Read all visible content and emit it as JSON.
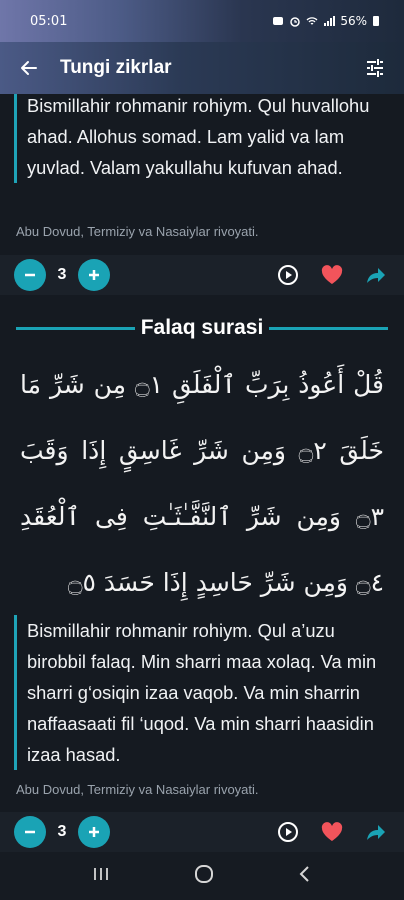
{
  "status": {
    "time": "05:01",
    "battery": "56%"
  },
  "app_bar": {
    "title": "Tungi zikrlar",
    "back_icon": "arrow-left-icon",
    "settings_icon": "tune-icon"
  },
  "ikhlas": {
    "translit": "Bismillahir rohmanir rohiym. Qul huvallohu ahad. Allohus somad. Lam yalid va lam yuvlad. Valam yakullahu kufuvan ahad.",
    "source": "Abu Dovud, Termiziy va Nasaiylar rivoyati.",
    "count": "3"
  },
  "falaq": {
    "title": "Falaq surasi",
    "arabic": "قُلْ أَعُوذُ بِرَبِّ ٱلْفَلَقِ ۝١ مِن شَرِّ مَا خَلَقَ ۝٢ وَمِن شَرِّ غَاسِقٍ إِذَا وَقَبَ ۝٣ وَمِن شَرِّ ٱلنَّفَّـٰثَـٰتِ فِى ٱلْعُقَدِ ۝٤ وَمِن شَرِّ حَاسِدٍ إِذَا حَسَدَ ۝٥",
    "translit": "Bismillahir rohmanir rohiym. Qul a’uzu birobbil falaq. Min sharri maa xolaq. Va min sharri g‘osiqin izaa vaqob. Va min sharrin naffaasaati fil ‘uqod. Va min sharri haasidin izaa hasad.",
    "source": "Abu Dovud, Termiziy va Nasaiylar rivoyati.",
    "count": "3"
  },
  "colors": {
    "accent": "#1aa3b5",
    "favorite": "#f2545b",
    "share": "#1aa3b5"
  }
}
